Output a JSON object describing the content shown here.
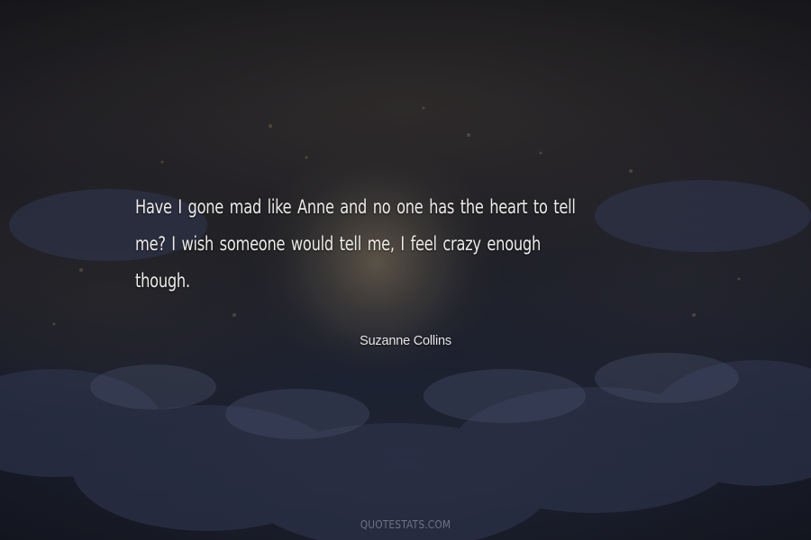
{
  "quote": {
    "lines": [
      "Have I gone mad like Anne and no one has the heart to tell",
      "me? I wish someone would tell me, I feel crazy enough",
      "though."
    ]
  },
  "author": "Suzanne Collins",
  "watermark": "QUOTESTATS.COM",
  "colors": {
    "background": "#15171d",
    "quote_text": "#ecebe8",
    "author_text": "#e6e6e6",
    "watermark_text": "#6e7282"
  }
}
